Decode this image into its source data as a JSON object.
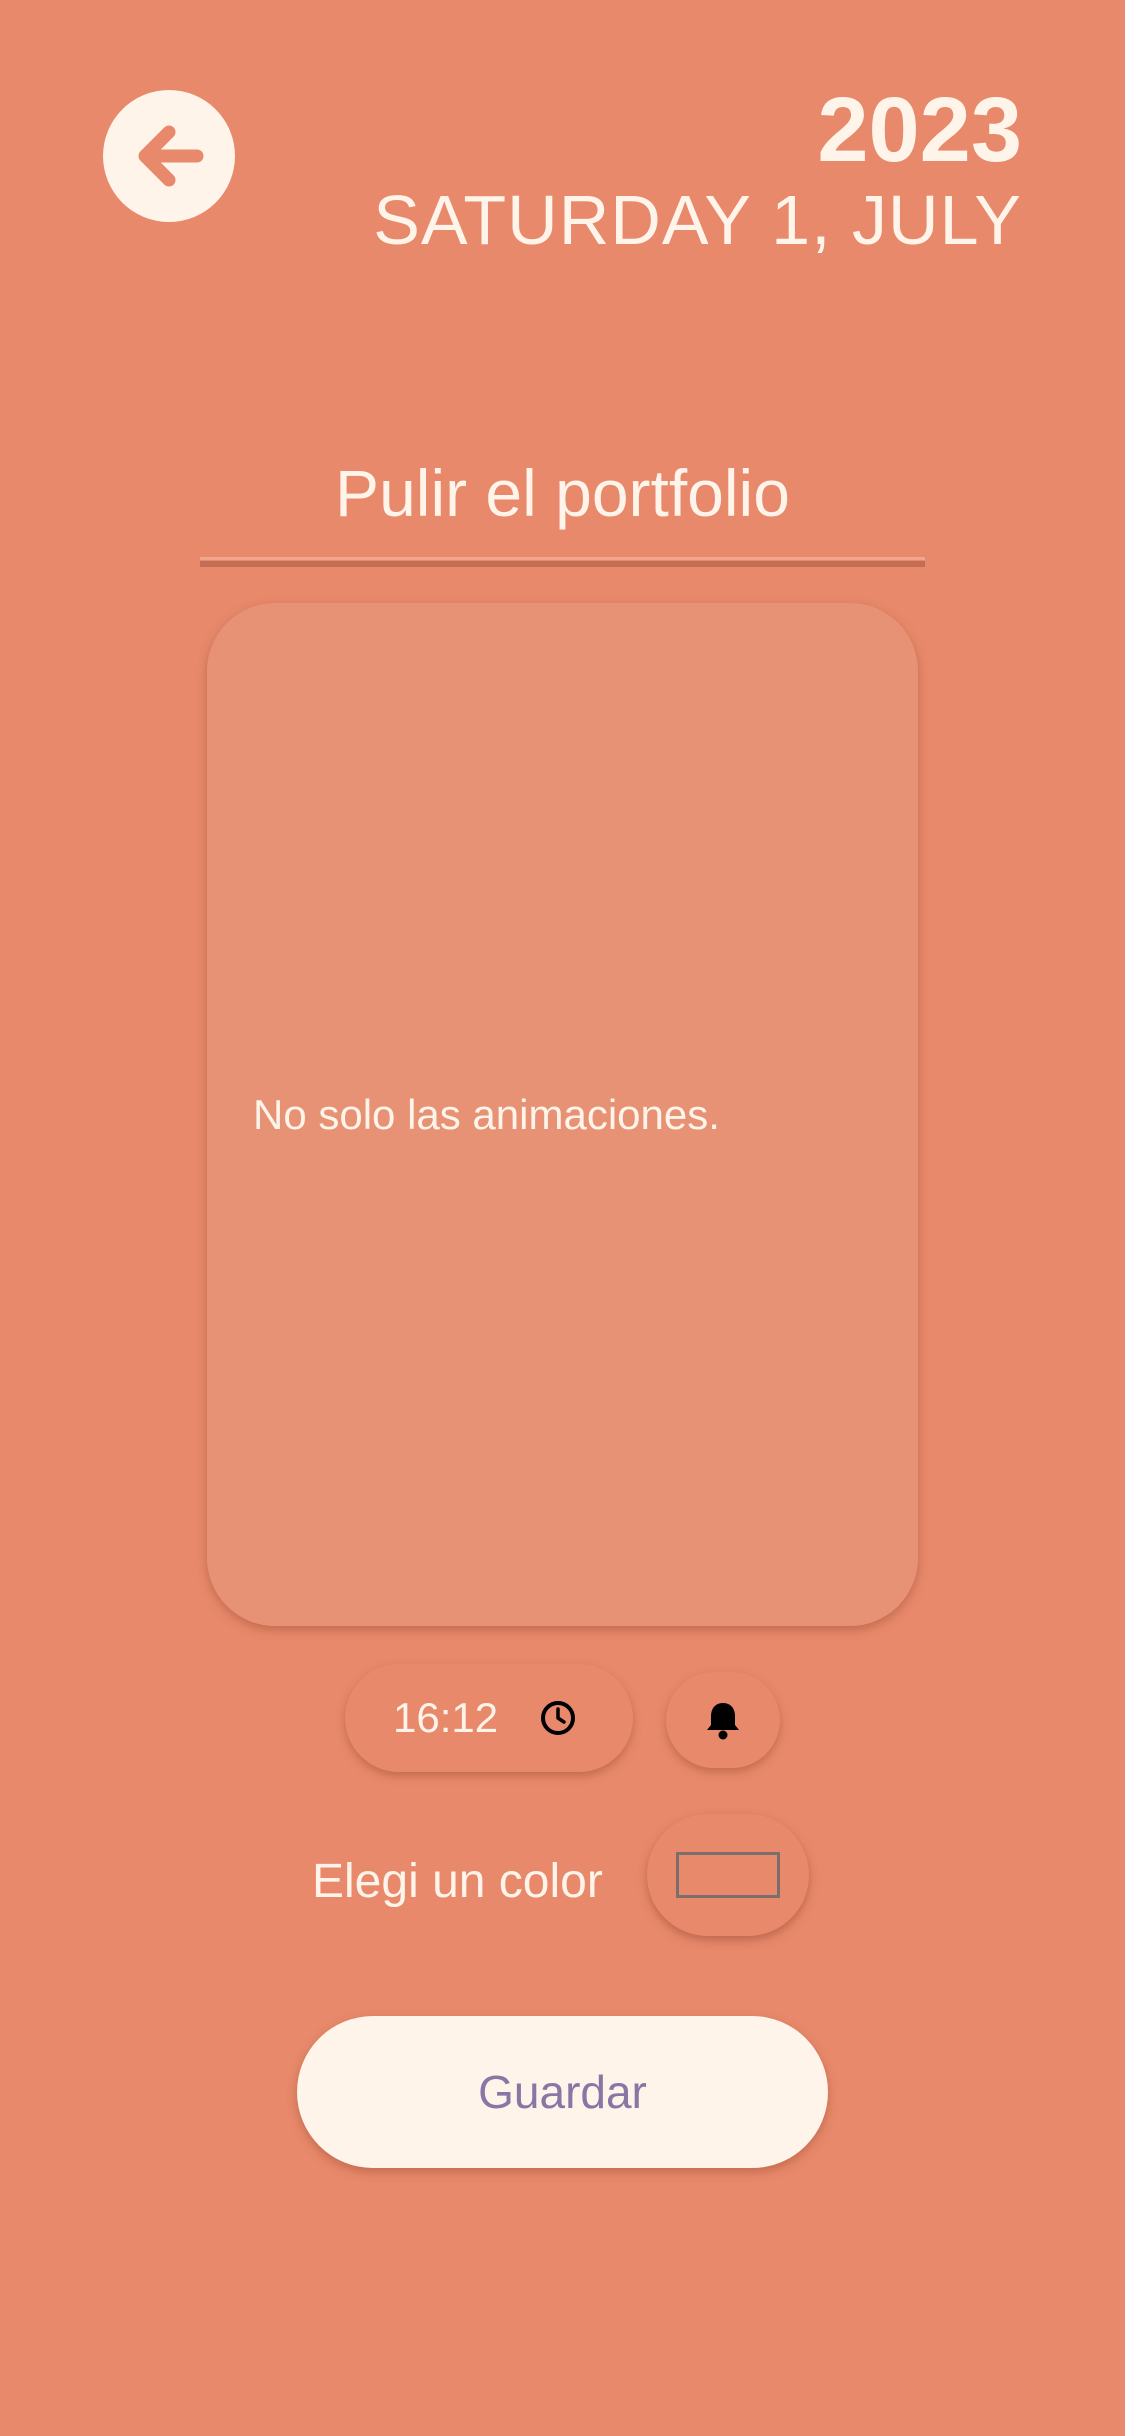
{
  "header": {
    "back_icon": "arrow-left-icon",
    "year": "2023",
    "date": "SATURDAY 1, JULY"
  },
  "task": {
    "title": "Pulir el portfolio",
    "note": "No solo las animaciones."
  },
  "reminder": {
    "time": "16:12",
    "time_icon": "clock-icon",
    "bell_icon": "bell-icon"
  },
  "color": {
    "label": "Elegi un color"
  },
  "actions": {
    "save_label": "Guardar"
  },
  "colors": {
    "background": "#E8896B",
    "card": "#E89275",
    "light": "#FFF4EA",
    "save_text": "#8877A5"
  }
}
